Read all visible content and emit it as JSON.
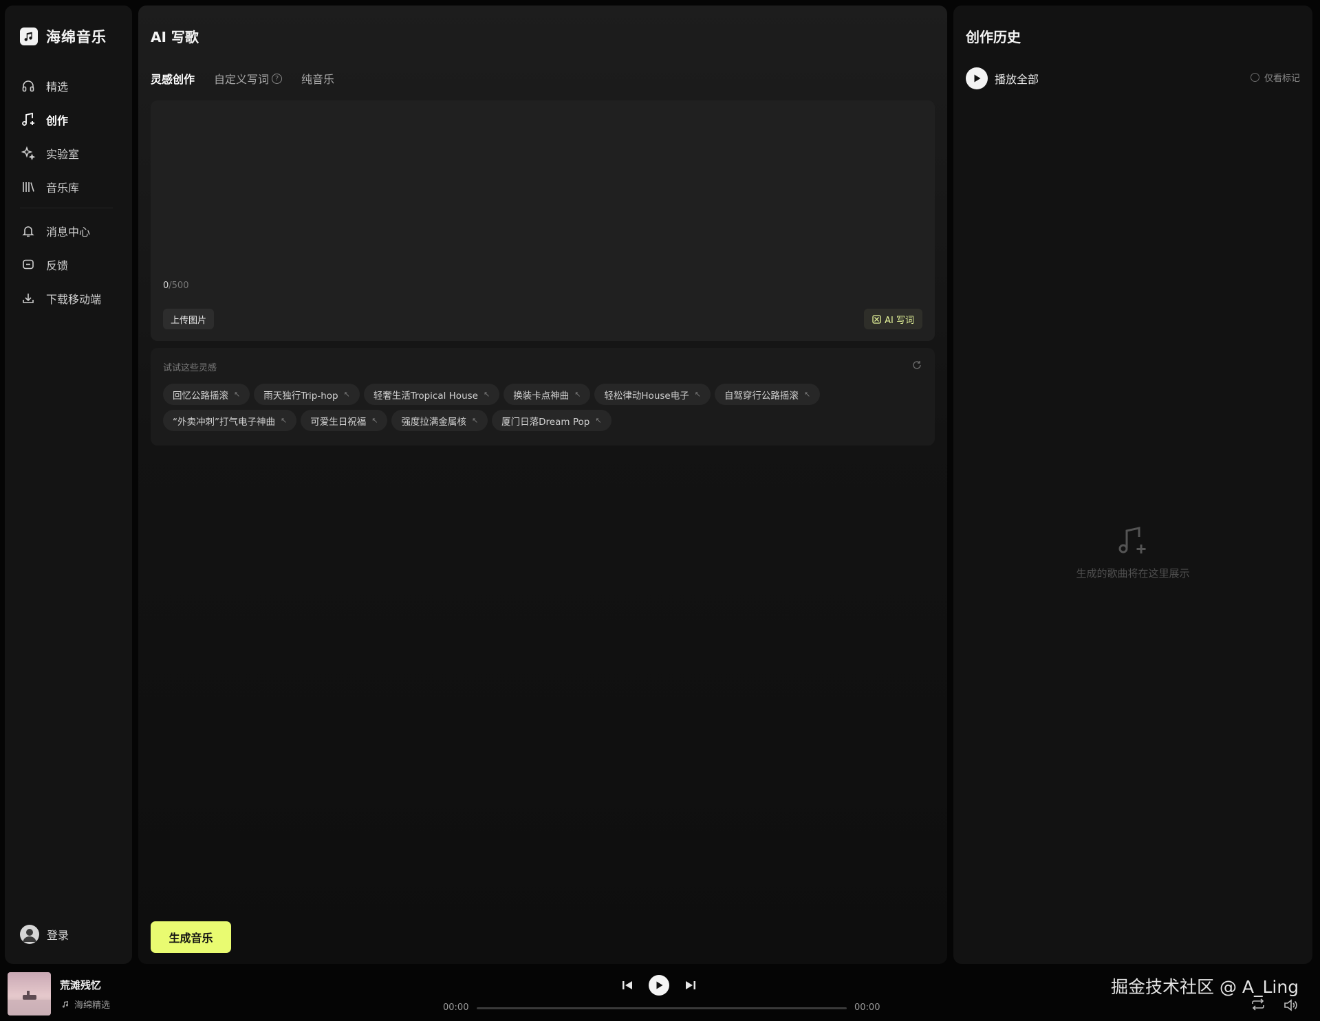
{
  "app": {
    "name": "海绵音乐"
  },
  "sidebar": {
    "items": [
      {
        "label": "精选",
        "icon": "headphones-icon",
        "active": false
      },
      {
        "label": "创作",
        "icon": "music-note-sparkle-icon",
        "active": true
      },
      {
        "label": "实验室",
        "icon": "sparkle-icon",
        "active": false
      },
      {
        "label": "音乐库",
        "icon": "library-icon",
        "active": false
      }
    ],
    "secondary_items": [
      {
        "label": "消息中心",
        "icon": "bell-icon"
      },
      {
        "label": "反馈",
        "icon": "feedback-icon"
      },
      {
        "label": "下载移动端",
        "icon": "download-icon"
      }
    ],
    "login_label": "登录"
  },
  "main": {
    "title": "AI 写歌",
    "tabs": [
      {
        "label": "灵感创作",
        "active": true
      },
      {
        "label": "自定义写词",
        "active": false,
        "has_help": true
      },
      {
        "label": "纯音乐",
        "active": false
      }
    ],
    "prompt": {
      "value": "",
      "placeholder": "",
      "count": "0",
      "max": "/500"
    },
    "upload_label": "上传图片",
    "ai_lyrics_label": "AI 写词",
    "inspiration": {
      "title": "试试这些灵感",
      "rows": [
        [
          "回忆公路摇滚",
          "雨天独行Trip-hop",
          "轻奢生活Tropical House",
          "换装卡点神曲",
          "轻松律动House电子",
          "自驾穿行公路摇滚"
        ],
        [
          "“外卖冲刺”打气电子神曲",
          "可爱生日祝福",
          "强度拉满金属核",
          "厦门日落Dream Pop"
        ]
      ]
    },
    "generate_label": "生成音乐"
  },
  "history": {
    "title": "创作历史",
    "play_all_label": "播放全部",
    "only_marked_label": "仅看标记",
    "empty_text": "生成的歌曲将在这里展示"
  },
  "player": {
    "song_title": "荒滩残忆",
    "song_source": "海绵精选",
    "current_time": "00:00",
    "total_time": "00:00",
    "progress": 0
  },
  "watermark": "掘金技术社区 @ A_Ling",
  "colors": {
    "accent": "#e9fb71",
    "background": "#050505",
    "panel": "#141414"
  }
}
